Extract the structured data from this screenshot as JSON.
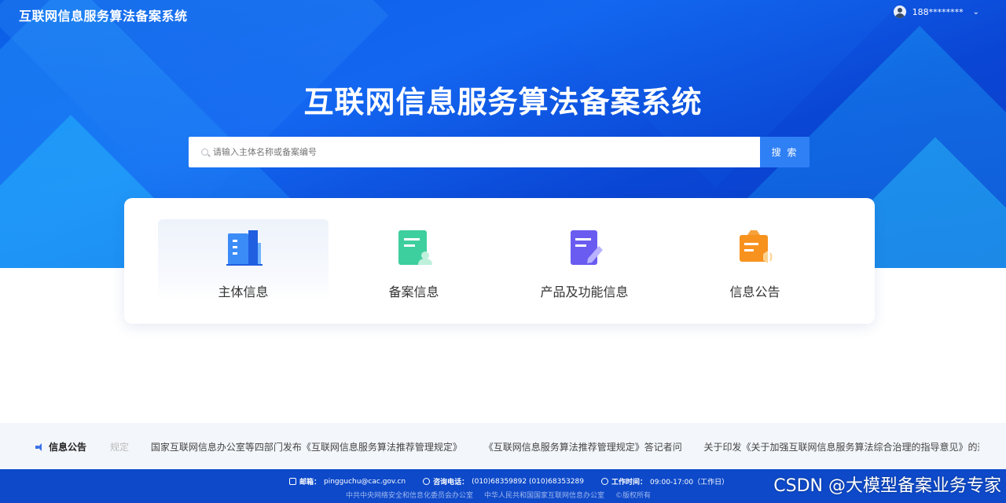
{
  "header": {
    "site_title": "互联网信息服务算法备案系统",
    "user_name": "188********"
  },
  "hero": {
    "title": "互联网信息服务算法备案系统"
  },
  "search": {
    "placeholder": "请输入主体名称或备案编号",
    "button_label": "搜 索"
  },
  "categories": [
    {
      "label": "主体信息",
      "icon": "building-icon",
      "active": true
    },
    {
      "label": "备案信息",
      "icon": "filing-doc-icon",
      "active": false
    },
    {
      "label": "产品及功能信息",
      "icon": "edit-doc-icon",
      "active": false
    },
    {
      "label": "信息公告",
      "icon": "announcement-icon",
      "active": false
    }
  ],
  "notice": {
    "heading": "信息公告",
    "items": [
      "规定",
      "国家互联网信息办公室等四部门发布《互联网信息服务算法推荐管理规定》",
      "《互联网信息服务算法推荐管理规定》答记者问",
      "关于印发《关于加强互联网信息服务算法综合治理的指导意见》的通知"
    ]
  },
  "footer": {
    "email_label": "邮箱：",
    "email": "pingguchu@cac.gov.cn",
    "phone_label": "咨询电话：",
    "phone": "(010)68359892   (010)68353289",
    "hours_label": "工作时间：",
    "hours": "09:00-17:00（工作日）",
    "org1": "中共中央网络安全和信息化委员会办公室",
    "org2": "中华人民共和国国家互联网信息办公室",
    "copyright": "©版权所有"
  },
  "watermark": "CSDN @大模型备案业务专家",
  "colors": {
    "primary": "#2f80f5",
    "footer_bg": "#0d49c9",
    "notice_bg": "#f3f6fa"
  }
}
